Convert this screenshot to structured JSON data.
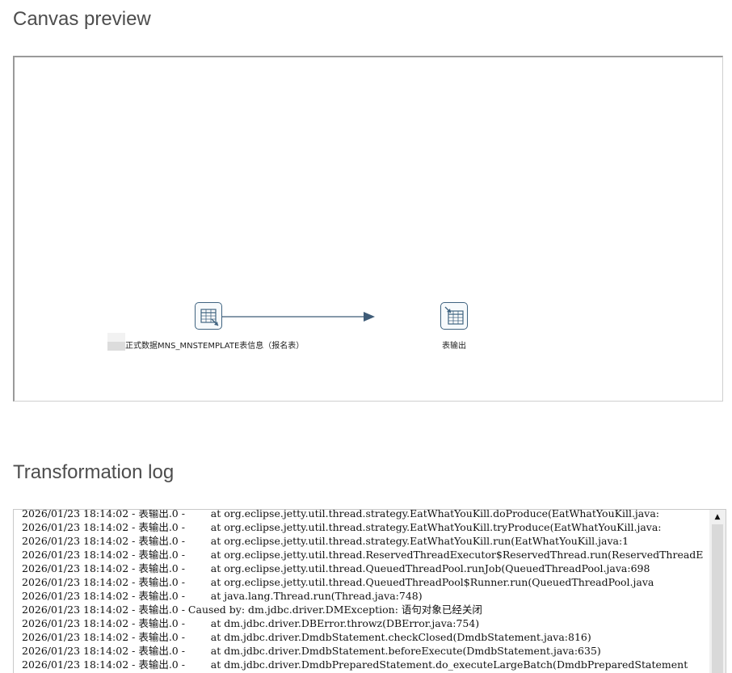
{
  "canvas_section": {
    "title": "Canvas preview",
    "steps": [
      {
        "id": "table-input",
        "label": "正式数据MNS_MNSTEMPLATE表信息（报名表）",
        "icon": "table-input-icon"
      },
      {
        "id": "table-output",
        "label": "表输出",
        "icon": "table-output-icon"
      }
    ],
    "hop_color": "#3f5c78"
  },
  "log_section": {
    "title": "Transformation log",
    "lines": [
      "2026/01/23 18:14:02 - 表输出.0 -        at org.eclipse.jetty.util.thread.strategy.EatWhatYouKill.doProduce(EatWhatYouKill.java:",
      "2026/01/23 18:14:02 - 表输出.0 -        at org.eclipse.jetty.util.thread.strategy.EatWhatYouKill.tryProduce(EatWhatYouKill.java:",
      "2026/01/23 18:14:02 - 表输出.0 -        at org.eclipse.jetty.util.thread.strategy.EatWhatYouKill.run(EatWhatYouKill.java:1",
      "2026/01/23 18:14:02 - 表输出.0 -        at org.eclipse.jetty.util.thread.ReservedThreadExecutor$ReservedThread.run(ReservedThreadE",
      "2026/01/23 18:14:02 - 表输出.0 -        at org.eclipse.jetty.util.thread.QueuedThreadPool.runJob(QueuedThreadPool.java:698",
      "2026/01/23 18:14:02 - 表输出.0 -        at org.eclipse.jetty.util.thread.QueuedThreadPool$Runner.run(QueuedThreadPool.java",
      "2026/01/23 18:14:02 - 表输出.0 -        at java.lang.Thread.run(Thread.java:748)",
      "2026/01/23 18:14:02 - 表输出.0 - Caused by: dm.jdbc.driver.DMException: 语句对象已经关闭",
      "2026/01/23 18:14:02 - 表输出.0 -        at dm.jdbc.driver.DBError.throwz(DBError.java:754)",
      "2026/01/23 18:14:02 - 表输出.0 -        at dm.jdbc.driver.DmdbStatement.checkClosed(DmdbStatement.java:816)",
      "2026/01/23 18:14:02 - 表输出.0 -        at dm.jdbc.driver.DmdbStatement.beforeExecute(DmdbStatement.java:635)",
      "2026/01/23 18:14:02 - 表输出.0 -        at dm.jdbc.driver.DmdbPreparedStatement.do_executeLargeBatch(DmdbPreparedStatement"
    ],
    "scroll_up_icon": "scroll-up-arrow-icon"
  }
}
